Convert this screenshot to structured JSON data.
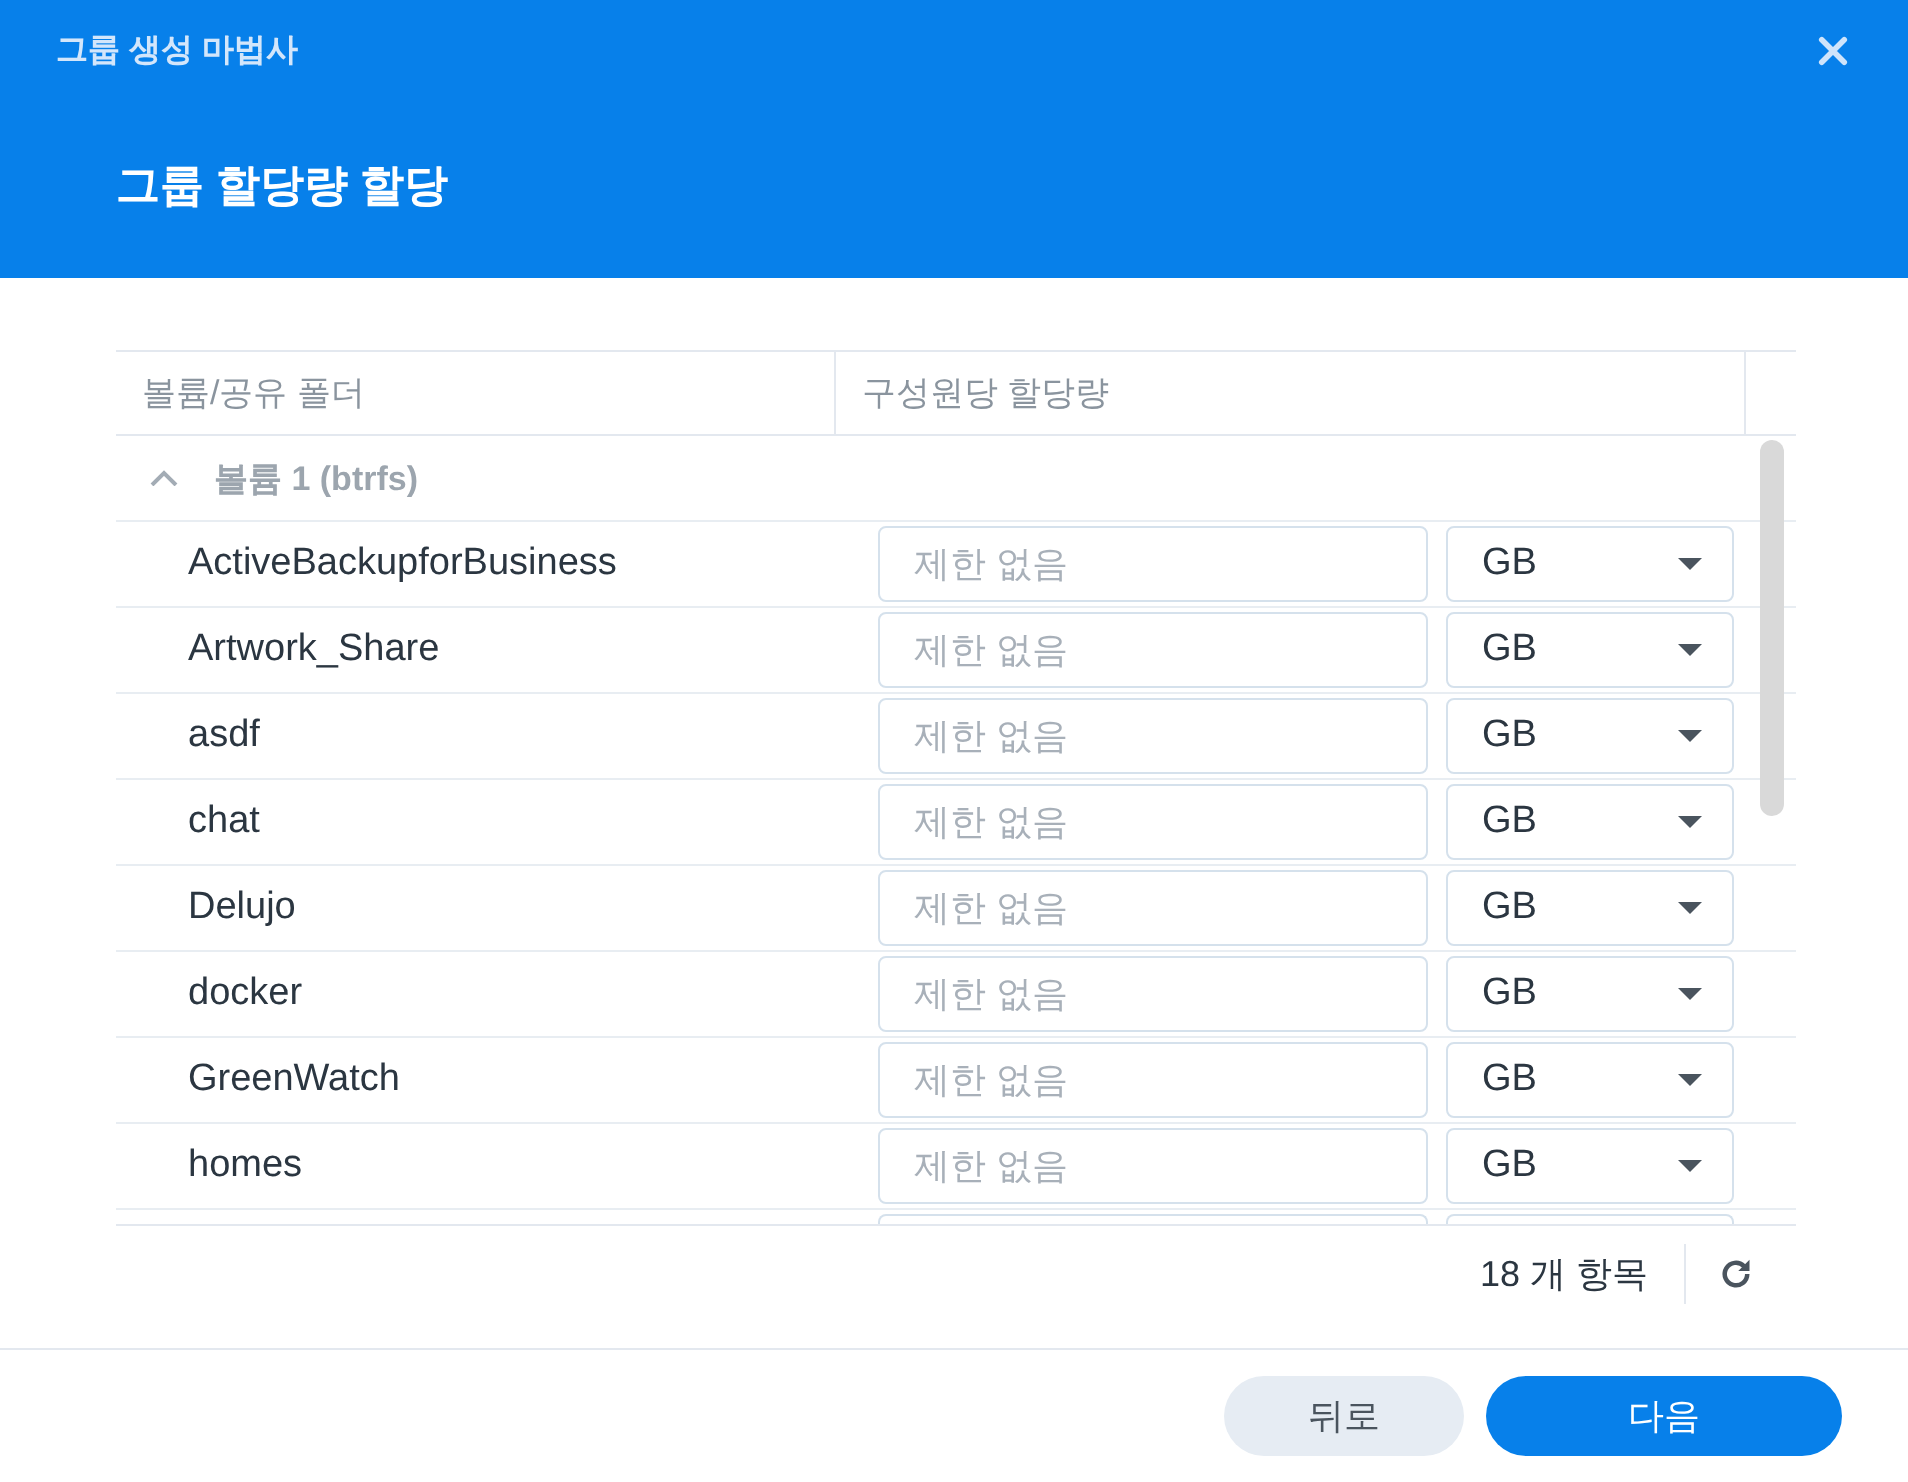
{
  "window": {
    "title": "그룹 생성 마법사"
  },
  "header": {
    "heading": "그룹 할당량 할당"
  },
  "table": {
    "columns": [
      "볼륨/공유 폴더",
      "구성원당 할당량"
    ],
    "groups": [
      {
        "label": "볼륨 1 (btrfs)",
        "expanded": true,
        "rows": [
          {
            "name": "ActiveBackupforBusiness",
            "quota": {
              "placeholder": "제한 없음"
            },
            "unit": "GB"
          },
          {
            "name": "Artwork_Share",
            "quota": {
              "placeholder": "제한 없음"
            },
            "unit": "GB"
          },
          {
            "name": "asdf",
            "quota": {
              "placeholder": "제한 없음"
            },
            "unit": "GB"
          },
          {
            "name": "chat",
            "quota": {
              "placeholder": "제한 없음"
            },
            "unit": "GB"
          },
          {
            "name": "Delujo",
            "quota": {
              "placeholder": "제한 없음"
            },
            "unit": "GB"
          },
          {
            "name": "docker",
            "quota": {
              "placeholder": "제한 없음"
            },
            "unit": "GB"
          },
          {
            "name": "GreenWatch",
            "quota": {
              "placeholder": "제한 없음"
            },
            "unit": "GB"
          },
          {
            "name": "homes",
            "quota": {
              "placeholder": "제한 없음"
            },
            "unit": "GB"
          }
        ]
      }
    ]
  },
  "footer": {
    "count": "18 개 항목"
  },
  "buttons": [
    {
      "label": "뒤로",
      "kind": "secondary"
    },
    {
      "label": "다음",
      "kind": "primary"
    }
  ]
}
